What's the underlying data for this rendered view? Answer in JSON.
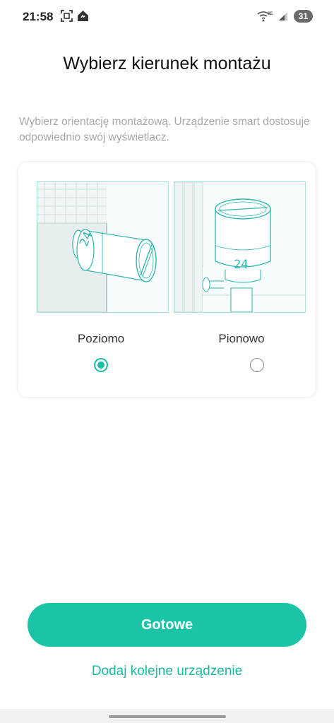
{
  "status_bar": {
    "time": "21:58",
    "battery": "31",
    "icons": [
      "screenshot-icon",
      "home-app-icon",
      "wifi-6e-icon",
      "signal-icon"
    ]
  },
  "page": {
    "title": "Wybierz kierunek montażu",
    "subtitle": "Wybierz orientację montażową. Urządzenie smart dostosuje odpowiednio swój wyświetlacz."
  },
  "orientation_options": [
    {
      "label": "Poziomo",
      "selected": true,
      "display_value": "24"
    },
    {
      "label": "Pionowo",
      "selected": false,
      "display_value": "24"
    }
  ],
  "actions": {
    "done_label": "Gotowe",
    "add_another_label": "Dodaj kolejne urządzenie"
  },
  "colors": {
    "accent": "#1cc4a6",
    "accent_text": "#1cb9a0",
    "illustration_line": "#2fb7ad",
    "subtitle": "#a8a8a8"
  }
}
